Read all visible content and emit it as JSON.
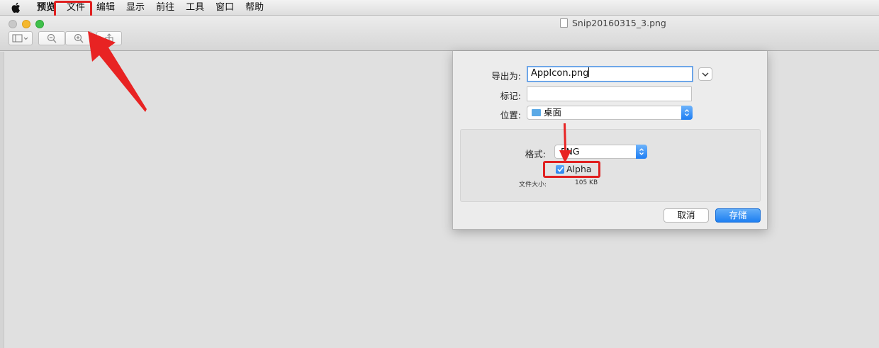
{
  "menubar": {
    "apple_icon": "apple-logo-icon",
    "items": [
      "预览",
      "文件",
      "编辑",
      "显示",
      "前往",
      "工具",
      "窗口",
      "帮助"
    ]
  },
  "window": {
    "title": "Snip20160315_3.png",
    "toolbar_icons": [
      "sidebar-toggle-icon",
      "zoom-out-icon",
      "zoom-in-icon",
      "share-icon"
    ]
  },
  "dialog": {
    "export_as_label": "导出为:",
    "export_as_value": "AppIcon.png",
    "tags_label": "标记:",
    "tags_value": "",
    "location_label": "位置:",
    "location_value": "桌面",
    "format_label": "格式:",
    "format_value": "PNG",
    "alpha_label": "Alpha",
    "alpha_checked": true,
    "file_size_label": "文件大小:",
    "file_size_value": "105 KB",
    "cancel_label": "取消",
    "save_label": "存储"
  },
  "colors": {
    "annotation_red": "#e02020",
    "accent_blue": "#1e7ff1"
  }
}
